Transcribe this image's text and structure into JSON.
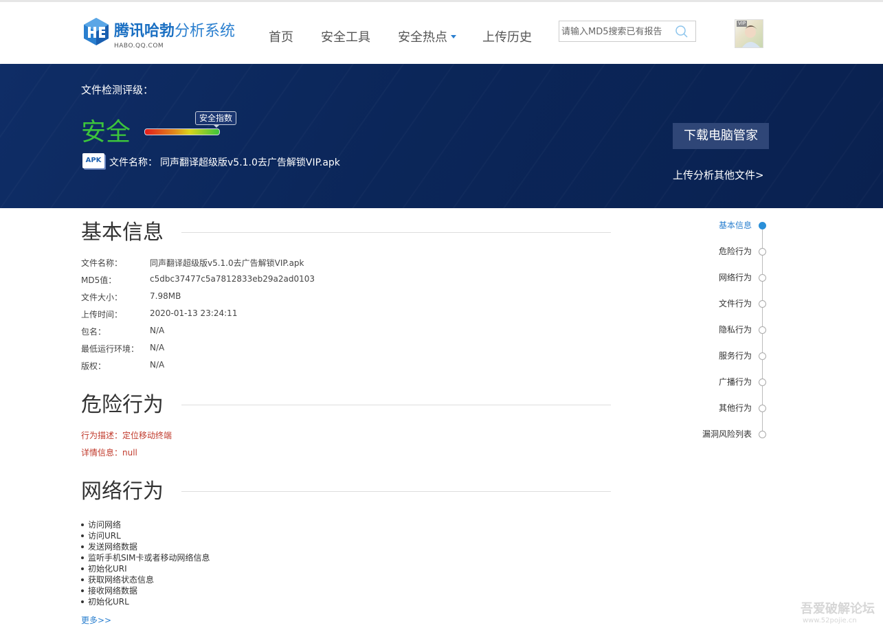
{
  "header": {
    "logo_title_strong": "腾讯哈勃",
    "logo_title_light": "分析系统",
    "logo_sub": "HABO.QQ.COM",
    "nav": [
      {
        "label": "首页"
      },
      {
        "label": "安全工具"
      },
      {
        "label": "安全热点"
      },
      {
        "label": "上传历史"
      }
    ],
    "search_placeholder": "请输入MD5搜索已有报告",
    "avatar_badge": "VIP"
  },
  "banner": {
    "label": "文件检测评级：",
    "rating": "安全",
    "score_tip": "安全指数",
    "apk_icon_text": "APK",
    "file_label": "文件名称：",
    "file_name": "同声翻译超级版v5.1.0去广告解锁VIP.apk",
    "download_button": "下载电脑管家",
    "upload_link": "上传分析其他文件>"
  },
  "basic": {
    "title": "基本信息",
    "rows": [
      {
        "key": "文件名称：",
        "value": "同声翻译超级版v5.1.0去广告解锁VIP.apk"
      },
      {
        "key": "MD5值：",
        "value": "c5dbc37477c5a7812833eb29a2ad0103"
      },
      {
        "key": "文件大小：",
        "value": "7.98MB"
      },
      {
        "key": "上传时间：",
        "value": "2020-01-13 23:24:11"
      },
      {
        "key": "包名：",
        "value": "N/A"
      },
      {
        "key": "最低运行环境：",
        "value": "N/A"
      },
      {
        "key": "版权：",
        "value": "N/A"
      }
    ]
  },
  "risk": {
    "title": "危险行为",
    "desc": "行为描述：定位移动终端",
    "detail": "详情信息：null"
  },
  "network": {
    "title": "网络行为",
    "items": [
      "访问网络",
      "访问URL",
      "发送网络数据",
      "监听手机SIM卡或者移动网络信息",
      "初始化URI",
      "获取网络状态信息",
      "接收网络数据",
      "初始化URL"
    ],
    "more": "更多>>"
  },
  "timeline": [
    {
      "label": "基本信息",
      "active": true
    },
    {
      "label": "危险行为"
    },
    {
      "label": "网络行为"
    },
    {
      "label": "文件行为"
    },
    {
      "label": "隐私行为"
    },
    {
      "label": "服务行为"
    },
    {
      "label": "广播行为"
    },
    {
      "label": "其他行为"
    },
    {
      "label": "漏洞风险列表"
    }
  ],
  "watermark": {
    "text": "吾爱破解论坛",
    "url": "www.52pojie.cn"
  },
  "colors": {
    "accent": "#2a7fcf",
    "banner": "#0b2659",
    "safe": "#3cc43c",
    "danger": "#c0392b"
  }
}
